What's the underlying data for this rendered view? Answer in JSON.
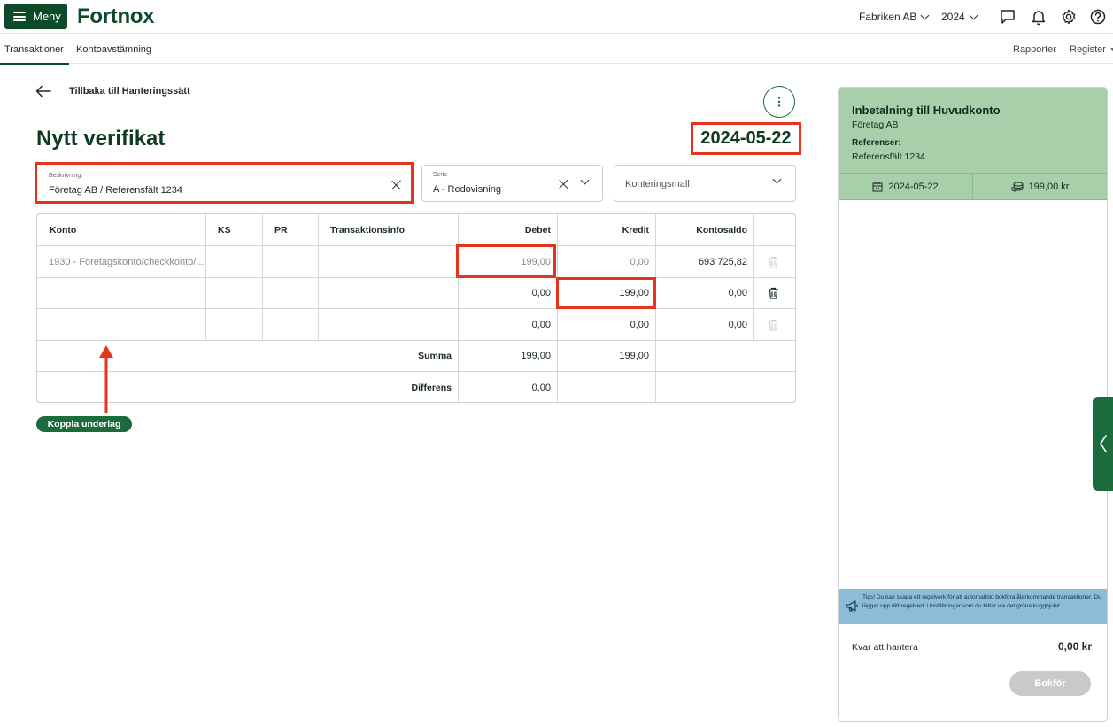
{
  "header": {
    "menu_label": "Meny",
    "logo": "Fortnox",
    "company": "Fabriken AB",
    "year": "2024",
    "icons": [
      "chat-icon",
      "bell-icon",
      "gear-icon",
      "help-icon"
    ]
  },
  "subnav": {
    "tabs": [
      {
        "label": "Transaktioner",
        "active": true
      },
      {
        "label": "Kontoavstämning",
        "active": false
      }
    ],
    "right": [
      "Rapporter",
      "Register"
    ]
  },
  "back_label": "Tillbaka till Hanteringssätt",
  "page_title": "Nytt verifikat",
  "date": "2024-05-22",
  "form": {
    "description_label": "Beskrivning:",
    "description_value": "Företag AB / Referensfält 1234",
    "serie_label": "Serie",
    "serie_value": "A - Redovisning",
    "konteringsmall_placeholder": "Konteringsmall"
  },
  "table": {
    "columns": [
      "Konto",
      "KS",
      "PR",
      "Transaktionsinfo",
      "Debet",
      "Kredit",
      "Kontosaldo"
    ],
    "rows": [
      {
        "konto": "1930 - Företagskonto/checkkonto/...",
        "ks": "",
        "pr": "",
        "info": "",
        "debet": "199,00",
        "kredit": "0,00",
        "saldo": "693 725,82"
      },
      {
        "konto": "",
        "ks": "",
        "pr": "",
        "info": "",
        "debet": "0,00",
        "kredit": "199,00",
        "saldo": "0,00"
      },
      {
        "konto": "",
        "ks": "",
        "pr": "",
        "info": "",
        "debet": "0,00",
        "kredit": "0,00",
        "saldo": "0,00"
      }
    ],
    "summa_label": "Summa",
    "summa_debet": "199,00",
    "summa_kredit": "199,00",
    "differens_label": "Differens",
    "differens_debet": "0,00"
  },
  "koppla_label": "Koppla underlag",
  "panel": {
    "title": "Inbetalning till Huvudkonto",
    "company": "Företag AB",
    "references_label": "Referenser:",
    "references_value": "Referensfält 1234",
    "date": "2024-05-22",
    "amount": "199,00 kr",
    "tips": "Tips! Du kan skapa ett regelverk för att automatiskt bokföra återkommande transaktioner. Du lägger upp ditt regelverk i inställningar som du hittar via det gröna kugghjulet.",
    "kvar_label": "Kvar att hantera",
    "kvar_value": "0,00 kr",
    "bokfor_label": "Bokför"
  },
  "colors": {
    "brand_dark": "#0c4a2a",
    "brand_green": "#1c6b3d",
    "panel_green": "#a6cfaa",
    "tips_blue": "#8dbcd8",
    "highlight_red": "#e5341d"
  }
}
